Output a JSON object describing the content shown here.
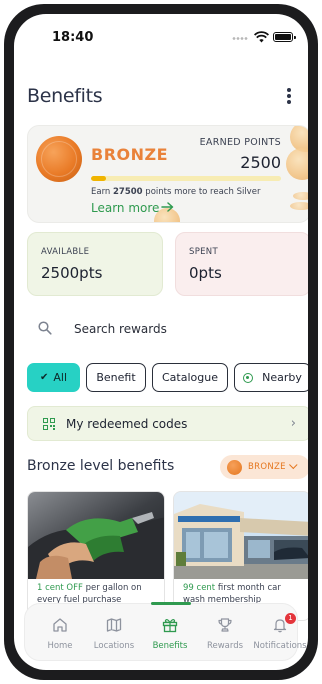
{
  "status_bar": {
    "time": "18:40"
  },
  "header": {
    "title": "Benefits"
  },
  "tier_card": {
    "tier": "BRONZE",
    "earned_label": "EARNED POINTS",
    "earned_points": "2500",
    "progress_fraction": 0.08,
    "earn_prefix": "Earn ",
    "earn_amount": "27500",
    "earn_suffix": " points more to reach Silver",
    "learn_more": "Learn more"
  },
  "stats": {
    "available_label": "AVAILABLE",
    "available_value": "2500pts",
    "spent_label": "SPENT",
    "spent_value": "0pts"
  },
  "search": {
    "placeholder": "Search rewards"
  },
  "filters": [
    {
      "label": "All",
      "active": true
    },
    {
      "label": "Benefit",
      "active": false
    },
    {
      "label": "Catalogue",
      "active": false
    },
    {
      "label": "Nearby",
      "active": false
    }
  ],
  "redeemed_codes": {
    "label": "My redeemed codes"
  },
  "section": {
    "title": "Bronze level benefits",
    "tier_select": "BRONZE"
  },
  "benefits": [
    {
      "highlight": "1 cent OFF",
      "text": " per gallon on every fuel purchase"
    },
    {
      "highlight": "99 cent",
      "text": " first month car wash membership"
    }
  ],
  "nav": [
    {
      "label": "Home",
      "icon": "home-icon"
    },
    {
      "label": "Locations",
      "icon": "map-icon"
    },
    {
      "label": "Benefits",
      "icon": "gift-icon",
      "active": true
    },
    {
      "label": "Rewards",
      "icon": "trophy-icon"
    },
    {
      "label": "Notifications",
      "icon": "bell-icon",
      "badge": "1"
    }
  ],
  "colors": {
    "accent_green": "#2f9a4f",
    "chip_active": "#27d1c4",
    "bronze": "#e9823a",
    "progress": "#f0b400"
  }
}
